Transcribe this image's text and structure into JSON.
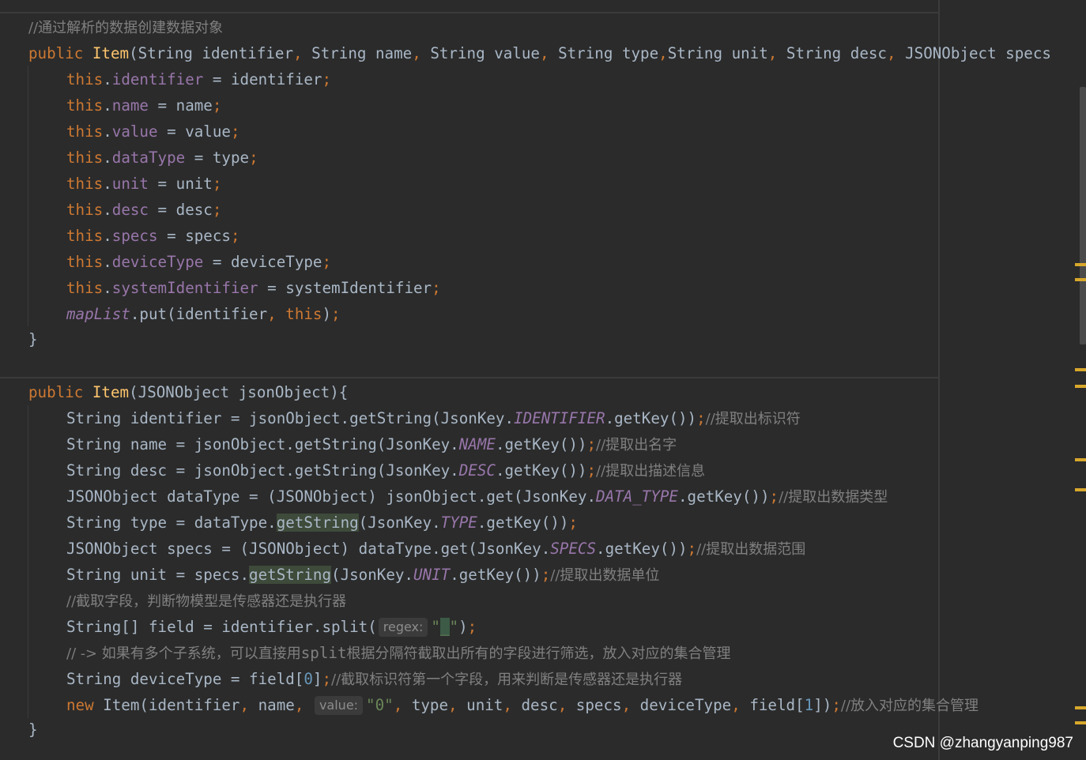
{
  "code": {
    "line1_comment": "//通过解析的数据创建数据对象",
    "line2": {
      "kw_public": "public",
      "ctor_name": "Item",
      "params": "(String identifier",
      "c1": ",",
      "p2": " String name",
      "c2": ",",
      "p3": " String value",
      "c3": ",",
      "p4": " String type",
      "c4": ",",
      "p5": "String unit",
      "c5": ",",
      "p6": " String desc",
      "c6": ",",
      "p7": " JSONObject specs"
    },
    "assign": [
      {
        "this": "this",
        "dot": ".",
        "field": "identifier",
        "eq": " = ",
        "val": "identifier",
        "semi": ";"
      },
      {
        "this": "this",
        "dot": ".",
        "field": "name",
        "eq": " = ",
        "val": "name",
        "semi": ";"
      },
      {
        "this": "this",
        "dot": ".",
        "field": "value",
        "eq": " = ",
        "val": "value",
        "semi": ";"
      },
      {
        "this": "this",
        "dot": ".",
        "field": "dataType",
        "eq": " = ",
        "val": "type",
        "semi": ";"
      },
      {
        "this": "this",
        "dot": ".",
        "field": "unit",
        "eq": " = ",
        "val": "unit",
        "semi": ";"
      },
      {
        "this": "this",
        "dot": ".",
        "field": "desc",
        "eq": " = ",
        "val": "desc",
        "semi": ";"
      },
      {
        "this": "this",
        "dot": ".",
        "field": "specs",
        "eq": " = ",
        "val": "specs",
        "semi": ";"
      },
      {
        "this": "this",
        "dot": ".",
        "field": "deviceType",
        "eq": " = ",
        "val": "deviceType",
        "semi": ";"
      },
      {
        "this": "this",
        "dot": ".",
        "field": "systemIdentifier",
        "eq": " = ",
        "val": "systemIdentifier",
        "semi": ";"
      }
    ],
    "maplist": {
      "field": "mapList",
      "call": ".put(identifier",
      "comma": ",",
      "this": " this",
      "end": ")",
      "semi": ";"
    },
    "close_brace": "}",
    "ctor2": {
      "kw_public": "public",
      "name": "Item",
      "params": "(JSONObject jsonObject){"
    },
    "l_identifier": {
      "a": "String identifier = jsonObject.getString(JsonKey.",
      "k": "IDENTIFIER",
      "b": ".getKey())",
      "semi": ";",
      "cm": "//提取出标识符"
    },
    "l_name": {
      "a": "String name = jsonObject.getString(JsonKey.",
      "k": "NAME",
      "b": ".getKey())",
      "semi": ";",
      "cm": "//提取出名字"
    },
    "l_desc": {
      "a": "String desc = jsonObject.getString(JsonKey.",
      "k": "DESC",
      "b": ".getKey())",
      "semi": ";",
      "cm": "//提取出描述信息"
    },
    "l_datatype": {
      "a": "JSONObject dataType = (JSONObject) jsonObject.get(JsonKey.",
      "k": "DATA_TYPE",
      "b": ".getKey())",
      "semi": ";",
      "cm": "//提取出数据类型"
    },
    "l_type": {
      "a": "String type = dataType.",
      "hl": "getString",
      "b": "(JsonKey.",
      "k": "TYPE",
      "c": ".getKey())",
      "semi": ";"
    },
    "l_specs": {
      "a": "JSONObject specs = (JSONObject) dataType.get(JsonKey.",
      "k": "SPECS",
      "b": ".getKey())",
      "semi": ";",
      "cm": "//提取出数据范围"
    },
    "l_unit": {
      "a": "String unit = specs.",
      "hl": "getString",
      "b": "(JsonKey.",
      "k": "UNIT",
      "c": ".getKey())",
      "semi": ";",
      "cm": "//提取出数据单位"
    },
    "l_cm1": "//截取字段，判断物模型是传感器还是执行器",
    "l_split": {
      "a": "String[] field = identifier.split(",
      "hint": "regex:",
      "q1": "\"",
      "u": "_",
      "q2": "\"",
      "b": ")",
      "semi": ";"
    },
    "l_cm2": {
      "a": "// -> 如果有多个子系统，可以直接用",
      "m": "split",
      "b": "根据分隔符截取出所有的字段进行筛选，放入对应的集合管理"
    },
    "l_devtype": {
      "a": "String deviceType = field[",
      "n": "0",
      "b": "]",
      "semi": ";",
      "cm": "//截取标识符第一个字段，用来判断是传感器还是执行器"
    },
    "l_new": {
      "kw": "new",
      "a": " Item(identifier",
      "c1": ",",
      "p2": " name",
      "c2": ",",
      "hint": "value:",
      "str": "\"0\"",
      "c3": ",",
      "p3": " type",
      "c4": ",",
      "p4": " unit",
      "c5": ",",
      "p5": " desc",
      "c6": ",",
      "p6": " specs",
      "c7": ",",
      "p7": " deviceType",
      "c8": ",",
      "p8": " field[",
      "n": "1",
      "p9": "])",
      "semi": ";",
      "cm": "//放入对应的集合管理"
    },
    "close_brace2": "}"
  },
  "watermark": "CSDN @zhangyanping987"
}
